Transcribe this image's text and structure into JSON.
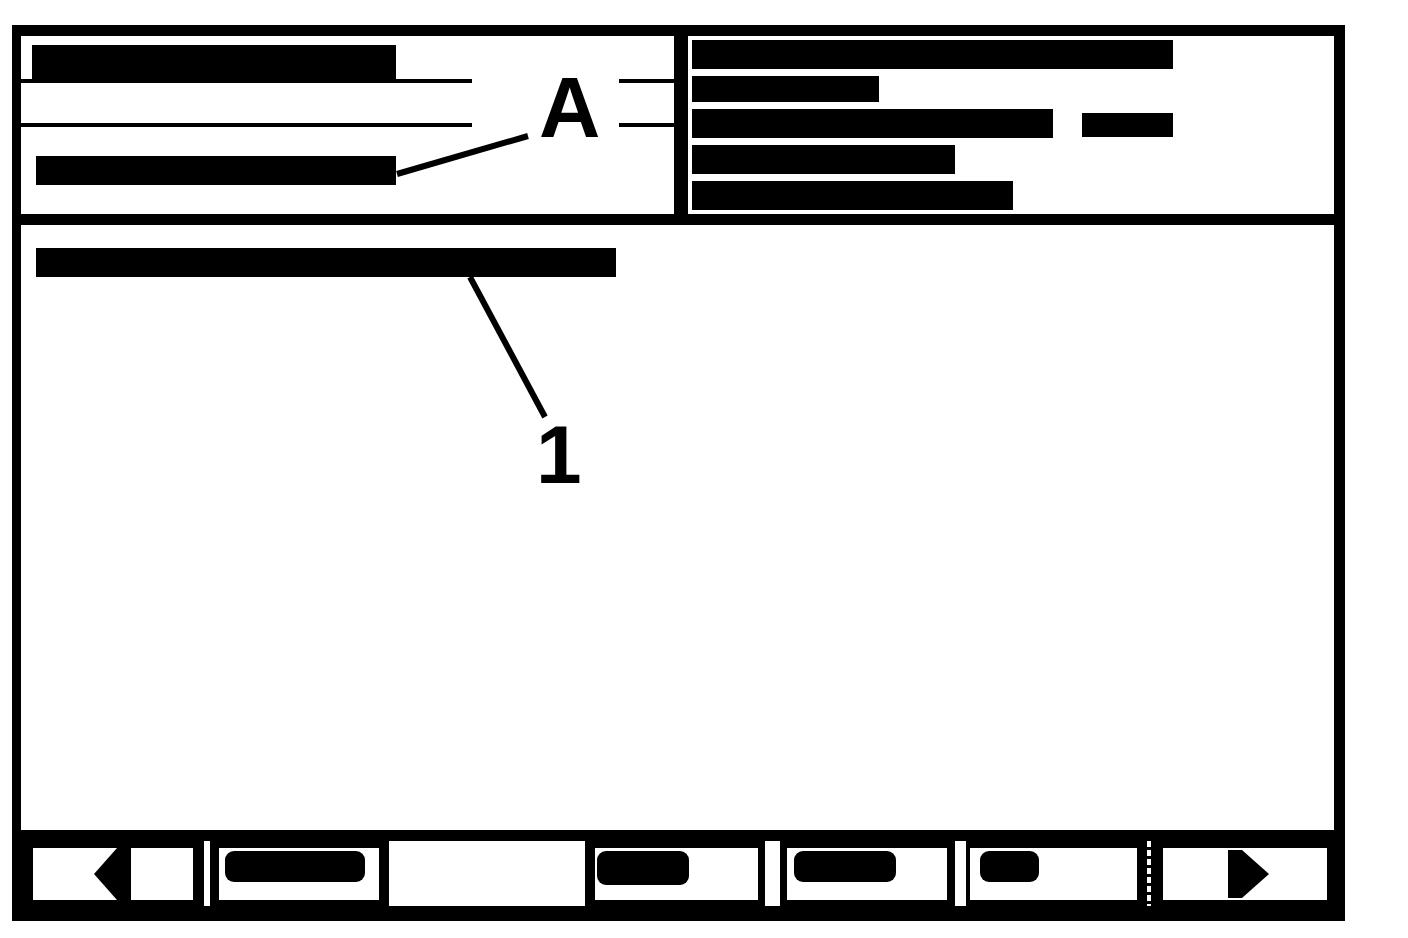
{
  "status_panel": {
    "rows": [
      {
        "kind": "redacted"
      },
      {
        "kind": "blank"
      },
      {
        "kind": "redacted"
      }
    ],
    "callout": "A"
  },
  "info_panel": {
    "rows": [
      {
        "kind": "redacted"
      },
      {
        "kind": "redacted"
      },
      {
        "kind": "redacted"
      },
      {
        "kind": "redacted"
      },
      {
        "kind": "redacted"
      }
    ]
  },
  "display_area": {
    "rows": [
      {
        "kind": "redacted"
      }
    ],
    "callout": "1"
  },
  "soft_keys": [
    {
      "kind": "prev"
    },
    {
      "kind": "redacted"
    },
    {
      "kind": "blank"
    },
    {
      "kind": "redacted"
    },
    {
      "kind": "redacted"
    },
    {
      "kind": "redacted"
    },
    {
      "kind": "next"
    }
  ]
}
